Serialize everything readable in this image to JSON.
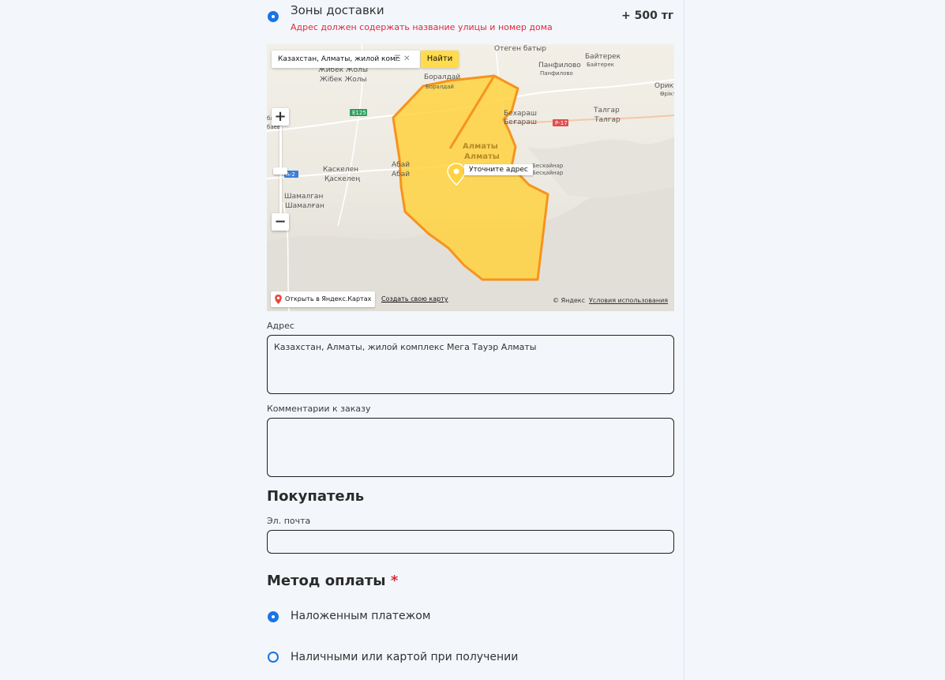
{
  "delivery": {
    "zone_title": "Зоны доставки",
    "zone_warning": "Адрес должен содержать название улицы и номер дома",
    "zone_price": "+ 500 тг"
  },
  "map": {
    "search_value": "Казахстан, Алматы, жилой комг",
    "find_button": "Найти",
    "pin_label": "Уточните адрес",
    "open_in_yandex": "Открыть в Яндекс.Картах",
    "create_map": "Создать свою карту",
    "copyright": "© Яндекс",
    "terms": "Условия использования",
    "zone_fill_color": "#ffd23f",
    "zone_stroke_color": "#f7931e",
    "places": {
      "zhibek": "Жибек Жолы",
      "zhibek2": "Жібек Жолы",
      "boralday": "Боралдай",
      "boralday2": "Боралдай",
      "otegen": "Отеген батыр",
      "panfilovo": "Панфилово",
      "panfilovo2": "Панфилово",
      "baiterek": "Байтерек",
      "baiterek2": "Байтерек",
      "orikti": "Ориктi",
      "orikti2": "Өріктi",
      "talgar": "Талгар",
      "talgar2": "Талгар",
      "beregash": "Бехараш",
      "beregash2": "Беғараш",
      "almaty": "Алматы",
      "almaty2": "Алматы",
      "beskainar": "Бескайнар",
      "beskainar2": "Бесқайнар",
      "kaskelen": "Каскелен",
      "kaskelen2": "Қаскелең",
      "abai": "Абай",
      "abai2": "Абай",
      "shamalgan": "Шамалган",
      "shamalgan2": "Шамалған",
      "e125": "E125",
      "p17": "Р-17",
      "a2": "А-2",
      "ba": "ба",
      "baev": "баев"
    }
  },
  "address": {
    "label": "Адрес",
    "value": "Казахстан, Алматы, жилой комплекс Мега Тауэр Алматы"
  },
  "comment": {
    "label": "Комментарии к заказу",
    "value": ""
  },
  "buyer": {
    "title": "Покупатель",
    "email_label": "Эл. почта",
    "email_value": ""
  },
  "payment": {
    "title": "Метод оплаты",
    "required_mark": "*",
    "options": [
      {
        "label": "Наложенным платежом",
        "selected": true
      },
      {
        "label": "Наличными или картой при получении",
        "selected": false
      }
    ]
  }
}
